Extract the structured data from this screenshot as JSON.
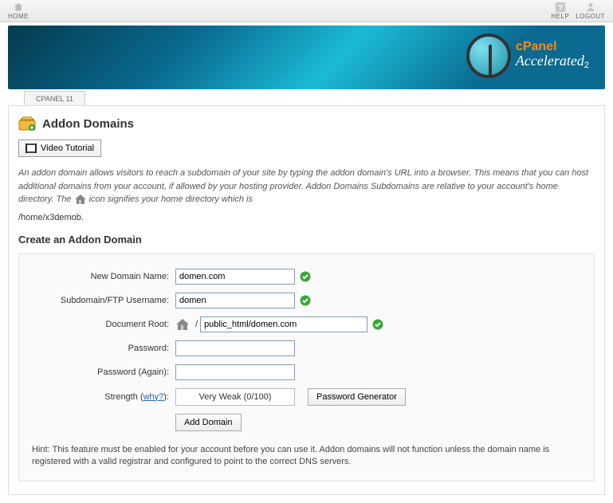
{
  "topbar": {
    "home": "HOME",
    "help": "HELP",
    "logout": "LOGOUT"
  },
  "brand": {
    "cp": "cPanel",
    "acc": "Accelerated",
    "two": "2"
  },
  "tab": "CPANEL 11",
  "page": {
    "title": "Addon Domains",
    "video_btn": "Video Tutorial",
    "desc_1": "An addon domain allows visitors to reach a subdomain of your site by typing the addon domain's URL into a browser. This means that you can host additional domains from your account, if allowed by your hosting provider. Addon Domains Subdomains are relative to your account's home directory. The ",
    "desc_2": " icon signifies your home directory which is",
    "home_path": "/home/x3demob.",
    "section_title": "Create an Addon Domain"
  },
  "form": {
    "labels": {
      "new_domain": "New Domain Name:",
      "subdomain": "Subdomain/FTP Username:",
      "docroot": "Document Root:",
      "password": "Password:",
      "password_again": "Password (Again):",
      "strength_prefix": "Strength (",
      "strength_why": "why?",
      "strength_suffix": "):"
    },
    "values": {
      "new_domain": "domen.com",
      "subdomain": "domen",
      "docroot": "public_html/domen.com",
      "password": "",
      "password_again": ""
    },
    "strength_text": "Very Weak (0/100)",
    "gen_btn": "Password Generator",
    "add_btn": "Add Domain",
    "hint": "Hint: This feature must be enabled for your account before you can use it. Addon domains will not function unless the domain name is registered with a valid registrar and configured to point to the correct DNS servers."
  }
}
